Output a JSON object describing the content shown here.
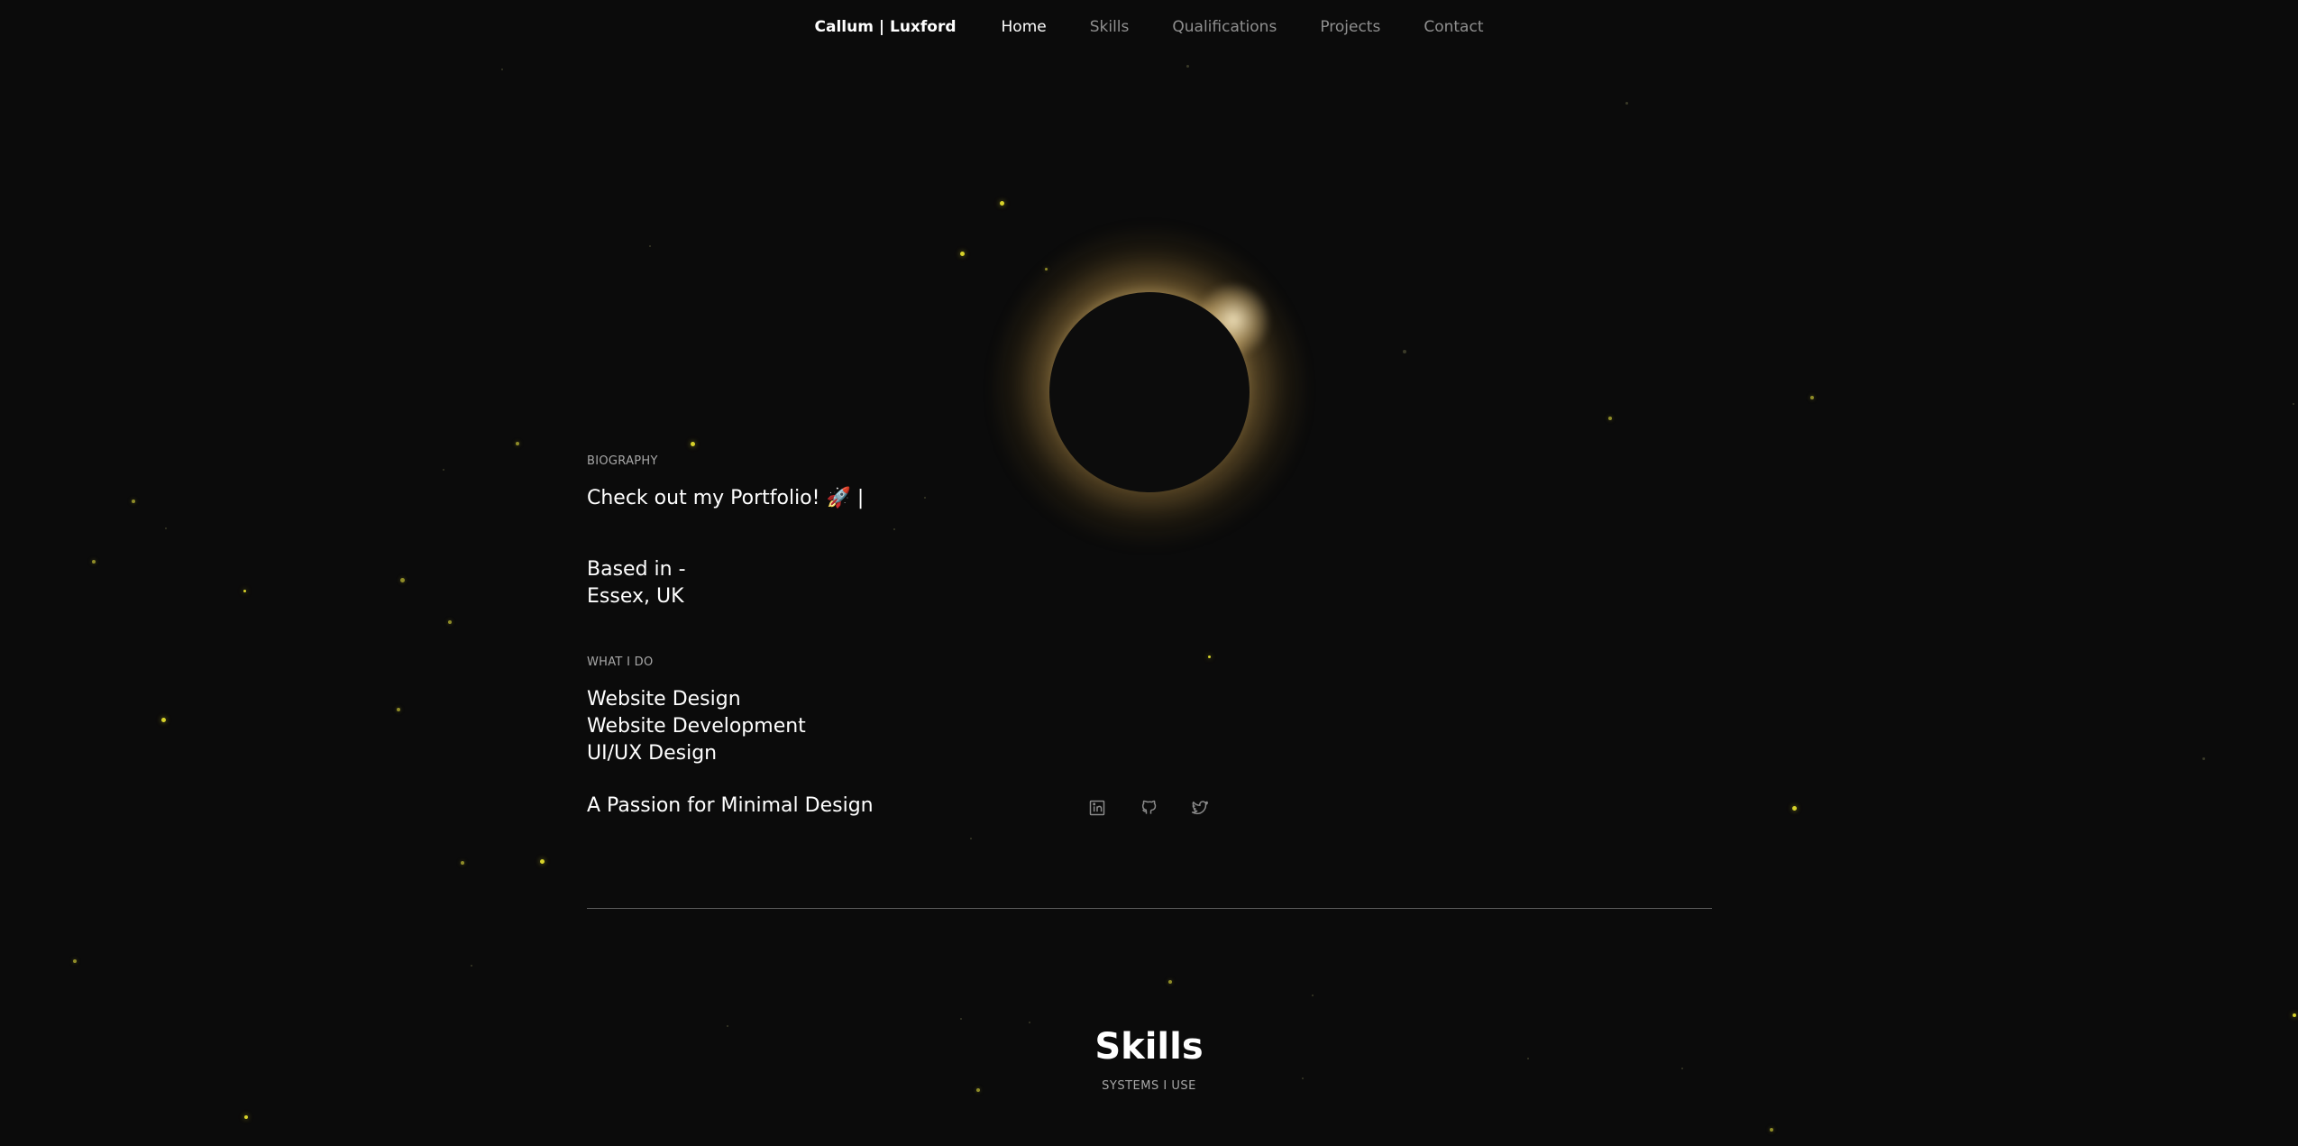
{
  "nav": {
    "brand": "Callum | Luxford",
    "items": [
      {
        "label": "Home",
        "active": true
      },
      {
        "label": "Skills",
        "active": false
      },
      {
        "label": "Qualifications",
        "active": false
      },
      {
        "label": "Projects",
        "active": false
      },
      {
        "label": "Contact",
        "active": false
      }
    ]
  },
  "biography": {
    "section_label": "BIOGRAPHY",
    "headline": "Check out my Portfolio! 🚀 |",
    "based_in_line1": "Based in -",
    "based_in_line2": "Essex, UK"
  },
  "what_i_do": {
    "section_label": "WHAT I DO",
    "items": [
      "Website Design",
      "Website Development",
      "UI/UX Design"
    ]
  },
  "tagline": "A Passion for Minimal Design",
  "socials": [
    "linkedin-icon",
    "github-icon",
    "twitter-icon"
  ],
  "skills": {
    "title": "Skills",
    "subtitle": "SYSTEMS I USE"
  },
  "colors": {
    "background": "#0b0b0b",
    "star": "#d7d22a",
    "corona": "#ffd98a",
    "nav_inactive": "#8f8f8f"
  }
}
